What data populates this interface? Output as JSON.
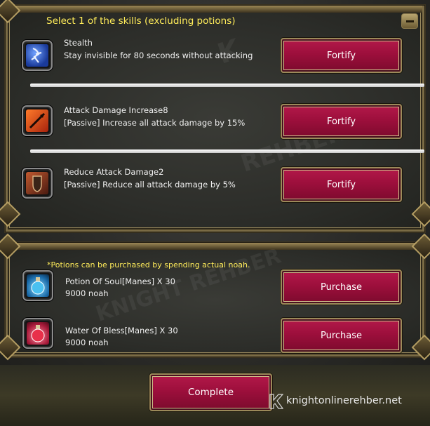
{
  "skills_panel": {
    "title": "Select 1 of the skills (excluding potions)",
    "skills": [
      {
        "name": "Stealth",
        "description": "Stay invisible for 80 seconds without attacking",
        "button": "Fortify",
        "icon": "stealth-skill-icon",
        "icon_color": "#2a4aa8"
      },
      {
        "name": "Attack Damage Increase8",
        "description": "[Passive] Increase all attack damage by 15%",
        "button": "Fortify",
        "icon": "attack-damage-skill-icon",
        "icon_color": "#c7481c"
      },
      {
        "name": "Reduce Attack Damage2",
        "description": "[Passive] Reduce all attack damage by 5%",
        "button": "Fortify",
        "icon": "reduce-damage-skill-icon",
        "icon_color": "#8a3a22"
      }
    ]
  },
  "potions_panel": {
    "note": "*Potions can be purchased by spending actual noah.",
    "potions": [
      {
        "name": "Potion Of Soul[Manes] X 30",
        "price": "9000 noah",
        "button": "Purchase",
        "icon": "blue-potion-icon",
        "icon_color": "#3aa0d8"
      },
      {
        "name": "Water Of Bless[Manes] X 30",
        "price": "9000 noah",
        "button": "Purchase",
        "icon": "red-potion-icon",
        "icon_color": "#d8284a"
      }
    ]
  },
  "complete_button": "Complete",
  "watermark_site": "knightonlinerehber.net"
}
